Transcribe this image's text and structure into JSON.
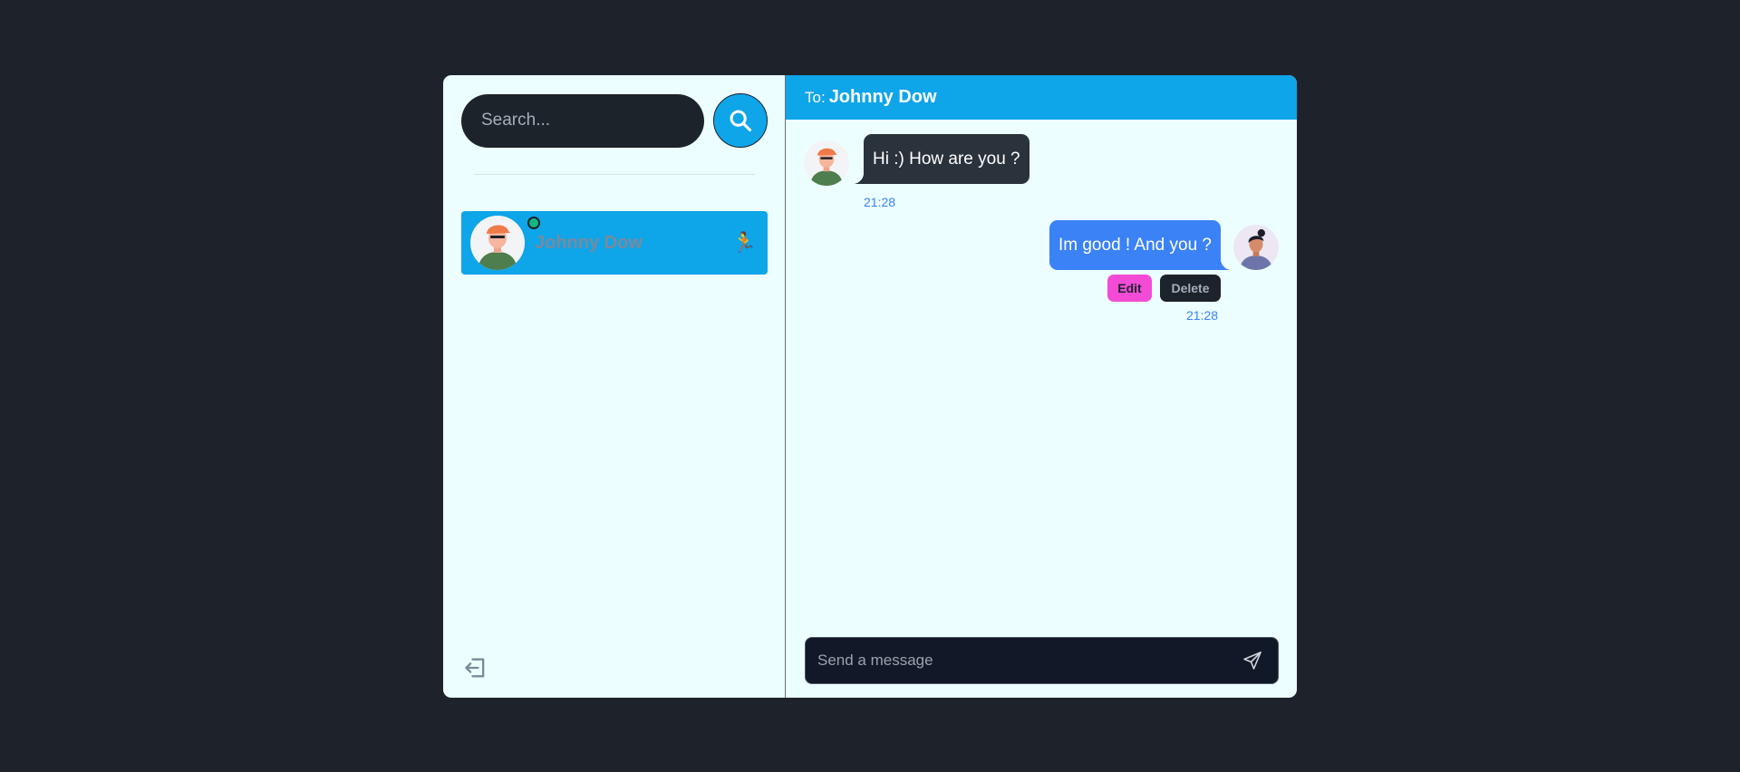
{
  "sidebar": {
    "search_placeholder": "Search...",
    "contacts": [
      {
        "name": "Johnny Dow",
        "status": "online",
        "status_icon": "runner-emoji",
        "emoji": "🏃"
      }
    ]
  },
  "chat": {
    "header_to": "To:",
    "header_name": "Johnny Dow",
    "messages": [
      {
        "direction": "incoming",
        "text": "Hi :) How are you ?",
        "time": "21:28"
      },
      {
        "direction": "outgoing",
        "text": "Im good ! And you ?",
        "time": "21:28",
        "edit_label": "Edit",
        "delete_label": "Delete"
      }
    ],
    "composer_placeholder": "Send a message"
  },
  "colors": {
    "accent": "#0ea5e9",
    "outgoing_bubble": "#3b82f6",
    "incoming_bubble": "#2a323c",
    "edit_button": "#f34bd6",
    "online": "#10b981"
  }
}
